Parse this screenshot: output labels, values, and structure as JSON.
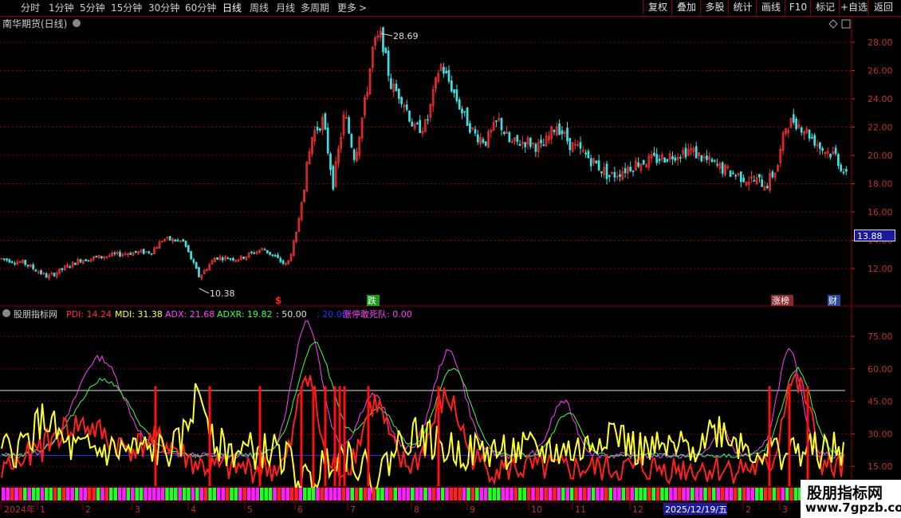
{
  "toolbar": {
    "periods": [
      {
        "label": "分时",
        "active": false
      },
      {
        "label": "1分钟",
        "active": false
      },
      {
        "label": "5分钟",
        "active": false
      },
      {
        "label": "15分钟",
        "active": false
      },
      {
        "label": "30分钟",
        "active": false
      },
      {
        "label": "60分钟",
        "active": false
      },
      {
        "label": "日线",
        "active": true
      },
      {
        "label": "周线",
        "active": false
      },
      {
        "label": "月线",
        "active": false
      },
      {
        "label": "多周期",
        "active": false
      },
      {
        "label": "更多",
        "active": false
      }
    ],
    "more_arrow": ">",
    "actions": [
      "复权",
      "叠加",
      "多股",
      "统计",
      "画线",
      "F10",
      "标记",
      "+自选",
      "返回"
    ]
  },
  "main_chart": {
    "title": "南华期货(日线)",
    "high_label": "28.69",
    "low_label": "10.38",
    "price_ticks": [
      "28.00",
      "26.00",
      "24.00",
      "22.00",
      "20.00",
      "18.00",
      "16.00",
      "14.00",
      "12.00"
    ],
    "current_price": "13.88",
    "markers": [
      {
        "text": "$",
        "color": "#ff2020"
      },
      {
        "text": "跌",
        "color": "#ffffff",
        "bg": "#1a9a1a"
      },
      {
        "text": "涨榜",
        "color": "#ffffff",
        "bg": "#8a2a2a"
      },
      {
        "text": "财",
        "color": "#ffffff",
        "bg": "#2a4a9a"
      }
    ]
  },
  "indicator": {
    "name": "股朋指标网",
    "values": [
      {
        "label": "PDI: 14.24",
        "color": "#ff3030"
      },
      {
        "label": "MDI: 31.38",
        "color": "#ffff40"
      },
      {
        "label": "ADX: 21.68",
        "color": "#ff40ff"
      },
      {
        "label": "ADXR: 19.82",
        "color": "#40ff40"
      },
      {
        "label": ": 50.00",
        "color": "#e0e0e0"
      },
      {
        "label": ": 20.00",
        "color": "#3030ff"
      },
      {
        "label": "涨停敢死队: 0.00",
        "color": "#ff40ff"
      }
    ],
    "ticks": [
      "75.00",
      "60.00",
      "45.00",
      "30.00",
      "15.00"
    ]
  },
  "date_axis": {
    "labels": [
      "2024年",
      "1",
      "2",
      "3",
      "4",
      "5",
      "6",
      "7",
      "8",
      "9",
      "10",
      "11",
      "12",
      "2025/12/19/五",
      "2",
      "3"
    ]
  },
  "watermark": {
    "title": "股朋指标网",
    "url": "www.7gpzb.com"
  },
  "colors": {
    "up": "#ff3030",
    "down": "#40e0e0",
    "grid": "#8b0000",
    "pdi": "#ff2020",
    "mdi": "#ffff30",
    "adx": "#ff40ff",
    "adxr": "#40ff40"
  }
}
